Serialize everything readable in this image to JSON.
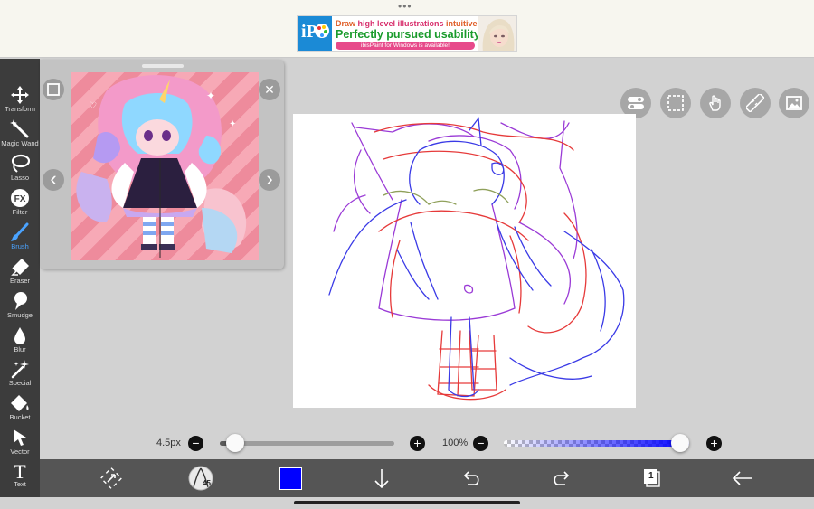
{
  "top": {
    "more_dots": "•••",
    "ad": {
      "logo_text": "iP",
      "line1_prefix": "Draw ",
      "line1_highlight": "high level illustrations",
      "line1_suffix": " intuitively!",
      "line2": "Perfectly pursued usability!",
      "line3": "ibisPaint for Windows is available!"
    }
  },
  "left_toolbar": {
    "tools": [
      {
        "label": "Transform",
        "icon": "transform-icon"
      },
      {
        "label": "Magic Wand",
        "icon": "magic-wand-icon"
      },
      {
        "label": "Lasso",
        "icon": "lasso-icon"
      },
      {
        "label": "Filter",
        "icon": "fx-filter-icon",
        "glyph": "FX"
      },
      {
        "label": "Brush",
        "icon": "brush-icon",
        "active": true
      },
      {
        "label": "Eraser",
        "icon": "eraser-icon"
      },
      {
        "label": "Smudge",
        "icon": "smudge-icon"
      },
      {
        "label": "Blur",
        "icon": "blur-drop-icon"
      },
      {
        "label": "Special",
        "icon": "special-sparkle-icon"
      },
      {
        "label": "Bucket",
        "icon": "bucket-icon"
      },
      {
        "label": "Vector",
        "icon": "vector-cursor-icon"
      },
      {
        "label": "Text",
        "icon": "text-t-icon",
        "glyph": "T"
      }
    ]
  },
  "reference_window": {
    "close_glyph": "✕",
    "prev_glyph": "‹",
    "next_glyph": "›",
    "more_glyph": "⋮"
  },
  "right_tools": [
    "toggle-settings-icon",
    "selection-icon",
    "hand-icon",
    "ruler-icon",
    "image-import-icon"
  ],
  "sliders": {
    "brush_size_label": "4.5px",
    "brush_size_fraction": 0.04,
    "opacity_label": "100%",
    "opacity_fraction": 1.0,
    "minus_glyph": "−",
    "plus_glyph": "+"
  },
  "bottom_bar": {
    "brush_preview_number": "45",
    "current_color": "#0000ff",
    "layer_count": "1"
  },
  "colors": {
    "toolbar_bg": "#3c3c3c",
    "bottom_bar_bg": "#555555",
    "workspace_bg": "#d2d2d2",
    "accent_blue": "#4aa3ff",
    "sketch_red": "#e63a3a",
    "sketch_blue": "#3a3ae6",
    "sketch_purple": "#9a3ad6"
  }
}
